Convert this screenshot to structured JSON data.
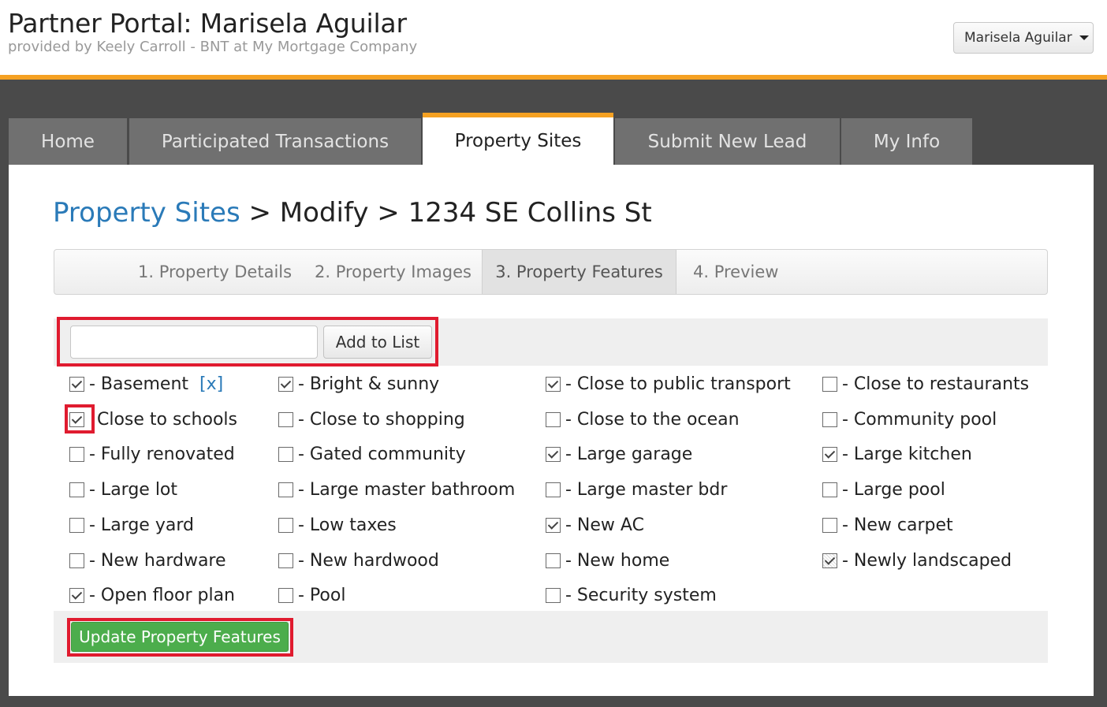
{
  "header": {
    "title": "Partner Portal: Marisela Aguilar",
    "subtitle": "provided by Keely Carroll - BNT at My Mortgage Company",
    "user_menu": "Marisela Aguilar"
  },
  "tabs": [
    {
      "label": "Home"
    },
    {
      "label": "Participated Transactions"
    },
    {
      "label": "Property Sites"
    },
    {
      "label": "Submit New Lead"
    },
    {
      "label": "My Info"
    }
  ],
  "breadcrumb": {
    "root": "Property Sites",
    "sep": ">",
    "mid": "Modify",
    "leaf": "1234 SE Collins St"
  },
  "steps": [
    {
      "label": "1. Property Details"
    },
    {
      "label": "2. Property Images"
    },
    {
      "label": "3. Property Features"
    },
    {
      "label": "4. Preview"
    }
  ],
  "add_feature": {
    "input_value": "",
    "button": "Add to List"
  },
  "features": [
    {
      "label": "- Basement",
      "checked": true,
      "remove": "[x]"
    },
    {
      "label": "- Bright & sunny",
      "checked": true
    },
    {
      "label": "- Close to public transport",
      "checked": true
    },
    {
      "label": "- Close to restaurants",
      "checked": false
    },
    {
      "label": "Close to schools",
      "checked": true
    },
    {
      "label": "- Close to shopping",
      "checked": false
    },
    {
      "label": "- Close to the ocean",
      "checked": false
    },
    {
      "label": "- Community pool",
      "checked": false
    },
    {
      "label": "- Fully renovated",
      "checked": false
    },
    {
      "label": "- Gated community",
      "checked": false
    },
    {
      "label": "- Large garage",
      "checked": true
    },
    {
      "label": "- Large kitchen",
      "checked": true
    },
    {
      "label": "- Large lot",
      "checked": false
    },
    {
      "label": "- Large master bathroom",
      "checked": false
    },
    {
      "label": "- Large master bdr",
      "checked": false
    },
    {
      "label": "- Large pool",
      "checked": false
    },
    {
      "label": "- Large yard",
      "checked": false
    },
    {
      "label": "- Low taxes",
      "checked": false
    },
    {
      "label": "- New AC",
      "checked": true
    },
    {
      "label": "- New carpet",
      "checked": false
    },
    {
      "label": "- New hardware",
      "checked": false
    },
    {
      "label": "- New hardwood",
      "checked": false
    },
    {
      "label": "- New home",
      "checked": false
    },
    {
      "label": "- Newly landscaped",
      "checked": true
    },
    {
      "label": "- Open floor plan",
      "checked": true
    },
    {
      "label": "- Pool",
      "checked": false
    },
    {
      "label": "- Security system",
      "checked": false
    }
  ],
  "update_button": "Update Property Features",
  "colors": {
    "accent": "#f5a122",
    "link": "#2a7ab8",
    "highlight": "#e01b2f",
    "primary_button": "#4cad4c"
  }
}
